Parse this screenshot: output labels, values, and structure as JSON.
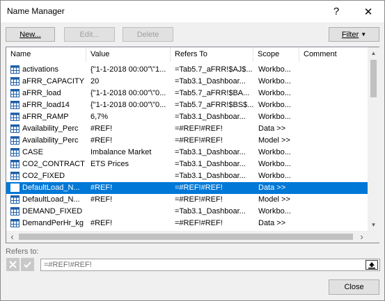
{
  "window": {
    "title": "Name Manager",
    "help": "?",
    "close": "✕"
  },
  "toolbar": {
    "new_label": "New...",
    "edit_label": "Edit...",
    "delete_label": "Delete",
    "filter_label": "Filter"
  },
  "columns": [
    "Name",
    "Value",
    "Refers To",
    "Scope",
    "Comment"
  ],
  "rows": [
    {
      "name": "activations",
      "value": "{\"1-1-2018 00:00\"\\\"1...",
      "refers": "=Tab5.7_aFRR!$AJ$...",
      "scope": "Workbo...",
      "comment": ""
    },
    {
      "name": "aFRR_CAPACITY",
      "value": "20",
      "refers": "=Tab3.1_Dashboar...",
      "scope": "Workbo...",
      "comment": ""
    },
    {
      "name": "aFRR_load",
      "value": "{\"1-1-2018 00:00\"\\\"0...",
      "refers": "=Tab5.7_aFRR!$BA...",
      "scope": "Workbo...",
      "comment": ""
    },
    {
      "name": "aFRR_load14",
      "value": "{\"1-1-2018 00:00\"\\\"0...",
      "refers": "=Tab5.7_aFRR!$BS$...",
      "scope": "Workbo...",
      "comment": ""
    },
    {
      "name": "aFRR_RAMP",
      "value": "6,7%",
      "refers": "=Tab3.1_Dashboar...",
      "scope": "Workbo...",
      "comment": ""
    },
    {
      "name": "Availability_Perc",
      "value": "#REF!",
      "refers": "=#REF!#REF!",
      "scope": "Data >>",
      "comment": ""
    },
    {
      "name": "Availability_Perc",
      "value": "#REF!",
      "refers": "=#REF!#REF!",
      "scope": "Model >>",
      "comment": ""
    },
    {
      "name": "CASE",
      "value": "Imbalance Market",
      "refers": "=Tab3.1_Dashboar...",
      "scope": "Workbo...",
      "comment": ""
    },
    {
      "name": "CO2_CONTRACT",
      "value": "ETS Prices",
      "refers": "=Tab3.1_Dashboar...",
      "scope": "Workbo...",
      "comment": ""
    },
    {
      "name": "CO2_FIXED",
      "value": "",
      "refers": "=Tab3.1_Dashboar...",
      "scope": "Workbo...",
      "comment": ""
    },
    {
      "name": "DefaultLoad_N...",
      "value": "#REF!",
      "refers": "=#REF!#REF!",
      "scope": "Data >>",
      "comment": ""
    },
    {
      "name": "DefaultLoad_N...",
      "value": "#REF!",
      "refers": "=#REF!#REF!",
      "scope": "Model >>",
      "comment": ""
    },
    {
      "name": "DEMAND_FIXED",
      "value": "",
      "refers": "=Tab3.1_Dashboar...",
      "scope": "Workbo...",
      "comment": ""
    },
    {
      "name": "DemandPerHr_kg",
      "value": "#REF!",
      "refers": "=#REF!#REF!",
      "scope": "Data >>",
      "comment": ""
    }
  ],
  "selected_row": 10,
  "refers_to": {
    "label": "Refers to:",
    "value": "=#REF!#REF!"
  },
  "footer": {
    "close_label": "Close"
  },
  "colors": {
    "selection": "#0078d7",
    "accent": "#0078d7"
  }
}
